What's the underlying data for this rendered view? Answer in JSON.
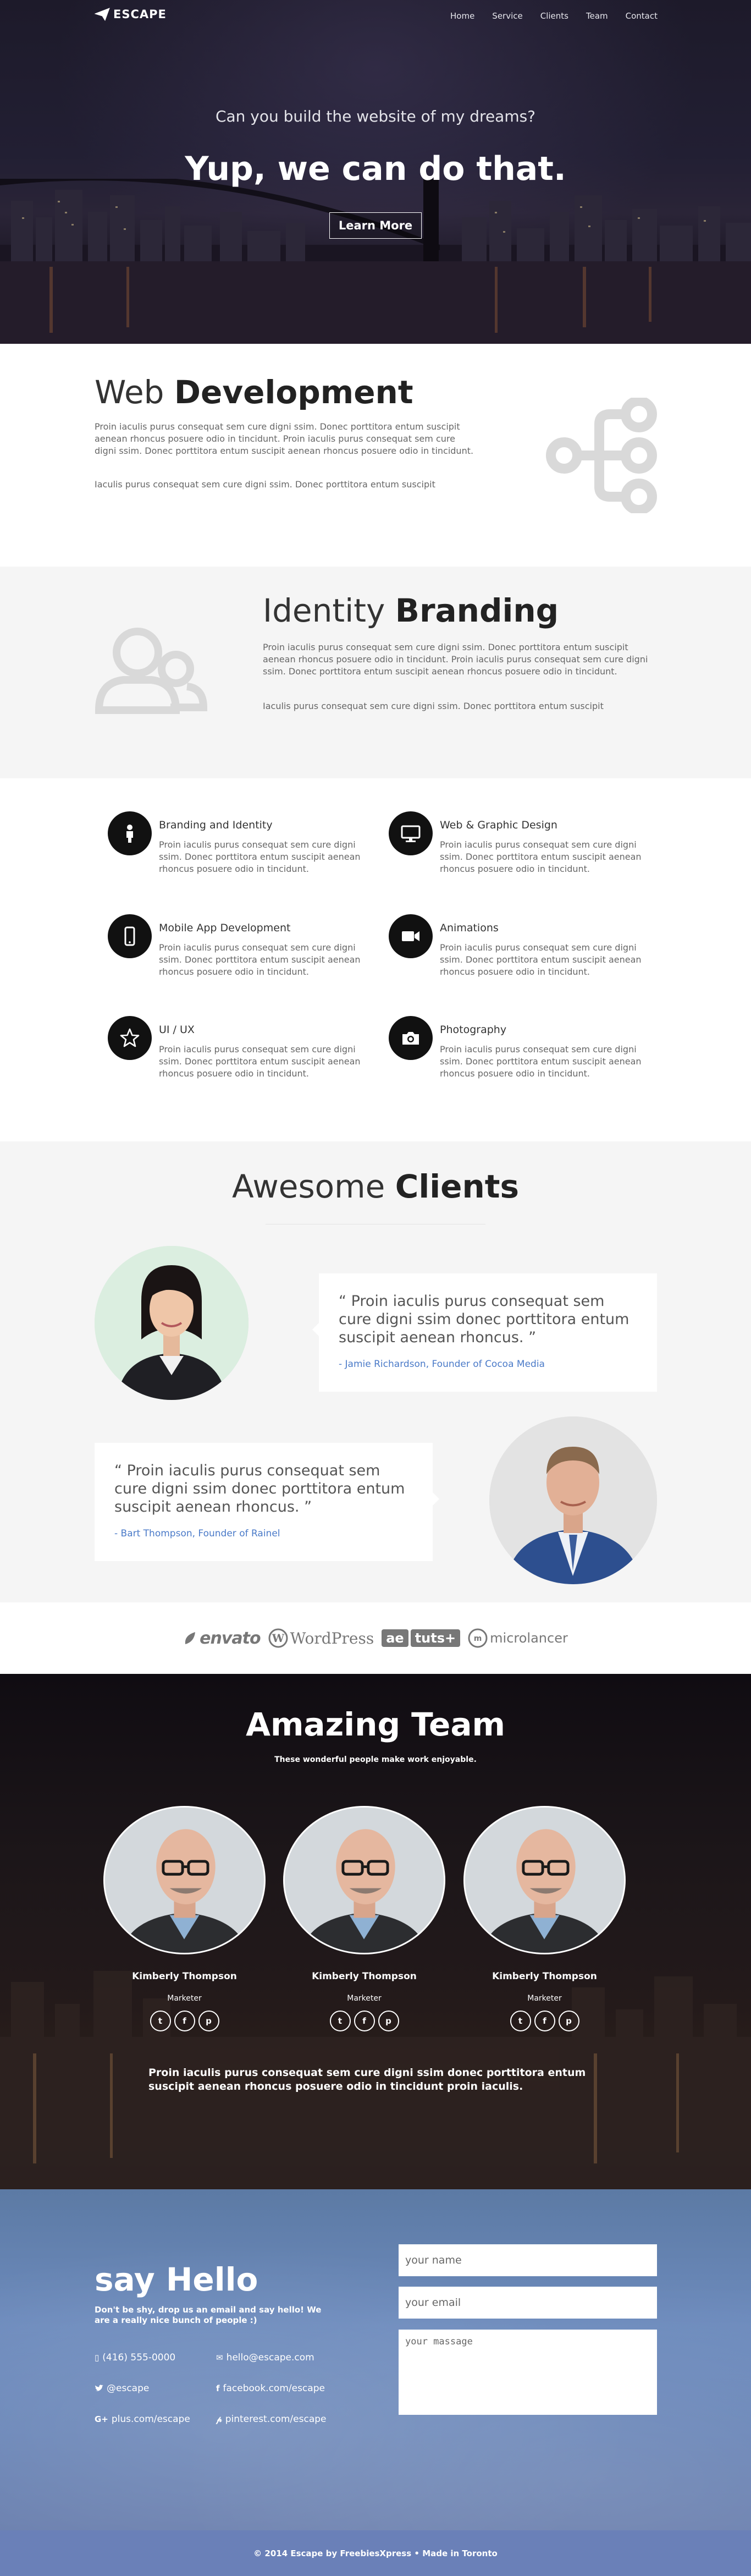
{
  "header": {
    "brand": "ESCAPE",
    "nav": [
      "Home",
      "Service",
      "Clients",
      "Team",
      "Contact"
    ]
  },
  "hero": {
    "question": "Can you build the website of my dreams?",
    "headline": "Yup, we can do that.",
    "button": "Learn More"
  },
  "webdev": {
    "title_light": "Web",
    "title_bold": "Development",
    "p1": "Proin iaculis purus consequat sem cure digni ssim. Donec porttitora entum suscipit aenean rhoncus posuere odio in tincidunt. Proin iaculis purus consequat sem cure digni ssim. Donec porttitora entum suscipit aenean rhoncus posuere odio in tincidunt.",
    "p2": "Iaculis purus consequat sem cure digni ssim. Donec porttitora entum suscipit"
  },
  "branding": {
    "title_light": "Identity",
    "title_bold": "Branding",
    "p1": "Proin iaculis purus consequat sem cure digni ssim. Donec porttitora entum suscipit aenean rhoncus posuere odio in tincidunt. Proin iaculis purus consequat sem cure digni ssim. Donec porttitora entum suscipit aenean rhoncus posuere odio in tincidunt.",
    "p2": "Iaculis purus consequat sem cure digni ssim. Donec porttitora entum suscipit"
  },
  "services": [
    {
      "title": "Branding and Identity",
      "icon": "person-icon",
      "desc": "Proin iaculis purus consequat sem cure digni ssim. Donec porttitora entum suscipit aenean rhoncus posuere odio in tincidunt."
    },
    {
      "title": "Web & Graphic Design",
      "icon": "monitor-icon",
      "desc": "Proin iaculis purus consequat sem cure digni ssim. Donec porttitora entum suscipit aenean rhoncus posuere odio in tincidunt."
    },
    {
      "title": "Mobile App Development",
      "icon": "mobile-icon",
      "desc": "Proin iaculis purus consequat sem cure digni ssim. Donec porttitora entum suscipit aenean rhoncus posuere odio in tincidunt."
    },
    {
      "title": "Animations",
      "icon": "video-camera-icon",
      "desc": "Proin iaculis purus consequat sem cure digni ssim. Donec porttitora entum suscipit aenean rhoncus posuere odio in tincidunt."
    },
    {
      "title": "UI / UX",
      "icon": "star-icon",
      "desc": "Proin iaculis purus consequat sem cure digni ssim. Donec porttitora entum suscipit aenean rhoncus posuere odio in tincidunt."
    },
    {
      "title": "Photography",
      "icon": "camera-icon",
      "desc": "Proin iaculis purus consequat sem cure digni ssim. Donec porttitora entum suscipit aenean rhoncus posuere odio in tincidunt."
    }
  ],
  "clients": {
    "title_light": "Awesome",
    "title_bold": "Clients",
    "testimonials": [
      {
        "quote": "“ Proin iaculis purus consequat sem cure digni ssim donec porttitora entum suscipit aenean rhoncus. ”",
        "author": "- Jamie Richardson, Founder of Cocoa Media"
      },
      {
        "quote": "“ Proin iaculis purus consequat sem cure digni ssim donec porttitora entum suscipit aenean rhoncus. ”",
        "author": "- Bart Thompson, Founder of Rainel"
      }
    ],
    "logos": [
      "envato",
      "WordPress",
      "ae",
      "tuts+",
      "microlancer"
    ]
  },
  "team": {
    "title": "Amazing Team",
    "subtitle": "These wonderful people make work enjoyable.",
    "members": [
      {
        "name": "Kimberly Thompson",
        "role": "Marketer"
      },
      {
        "name": "Kimberly Thompson",
        "role": "Marketer"
      },
      {
        "name": "Kimberly Thompson",
        "role": "Marketer"
      }
    ],
    "social": [
      "t",
      "f",
      "p"
    ],
    "blurb": "Proin iaculis purus consequat sem cure digni ssim donec porttitora entum suscipit aenean rhoncus posuere odio in tincidunt proin iaculis."
  },
  "contact": {
    "title_light": "say",
    "title_bold": "Hello",
    "intro": "Don't be shy, drop us an email and say hello! We are a really nice bunch of people :)",
    "phone": "(416) 555-0000",
    "email": "hello@escape.com",
    "twitter": "@escape",
    "facebook": "facebook.com/escape",
    "gplus": "plus.com/escape",
    "pinterest": "pinterest.com/escape",
    "gplus_prefix": "G+",
    "name_placeholder": "your name",
    "email_placeholder": "your email",
    "message_placeholder": "your massage"
  },
  "footer": {
    "text": "© 2014 Escape by FreebiesXpress • Made in Toronto"
  },
  "colors": {
    "accent_link": "#4a7ac8",
    "contact_blue": "#6d8bbd",
    "footer_blue": "#6a80b8"
  }
}
